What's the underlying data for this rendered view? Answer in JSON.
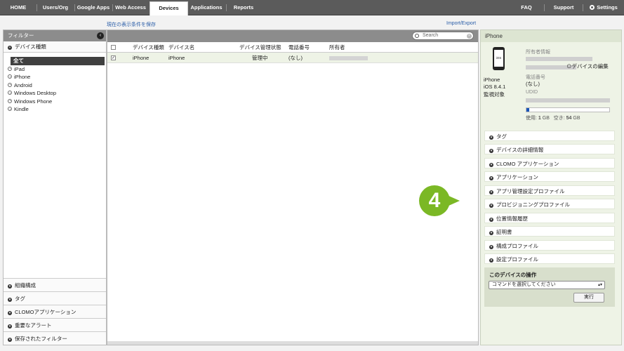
{
  "nav": {
    "home": "HOME",
    "users": "Users/Org",
    "google": "Google Apps",
    "web": "Web Access",
    "devices": "Devices",
    "applications": "Applications",
    "reports": "Reports",
    "faq": "FAQ",
    "support": "Support",
    "settings": "Settings"
  },
  "links": {
    "save_view": "現在の表示条件を保存",
    "import_export": "Import/Export"
  },
  "left": {
    "header": "フィルター",
    "section": "デバイス種類",
    "items": [
      "全て",
      "iPad",
      "iPhone",
      "Android",
      "Windows Desktop",
      "Windows Phone",
      "Kindle"
    ],
    "bottom": [
      "組織構成",
      "タグ",
      "CLOMOアプリケーション",
      "重要なアラート",
      "保存されたフィルター"
    ]
  },
  "search": {
    "placeholder": "Search"
  },
  "table": {
    "headers": [
      "デバイス種類",
      "デバイス名",
      "デバイス管理状態",
      "電話番号",
      "所有者"
    ],
    "rows": [
      {
        "type": "iPhone",
        "name": "iPhone",
        "status": "管理中",
        "phone": "(なし)",
        "checked": "✓"
      }
    ]
  },
  "right": {
    "header": "iPhone",
    "device_screen": "iOS",
    "device_model": "iPhone",
    "device_os": "iOS 8.4.1",
    "device_supervised": "監視対象",
    "owner_label": "所有者情報",
    "edit_link": "デバイスの編集",
    "phone_label": "電話番号",
    "phone_value": "(なし)",
    "udid_label": "UDID",
    "storage_used_label": "使用:",
    "storage_used_value": "1",
    "storage_free_label": "空き:",
    "storage_free_value": "54",
    "storage_unit": "GB",
    "storage_fraction": 0.018,
    "sections": [
      "タグ",
      "デバイスの詳細情報",
      "CLOMO アプリケーション",
      "アプリケーション",
      "アプリ管理設定プロファイル",
      "プロビジョニングプロファイル",
      "位置情報履歴",
      "証明書",
      "構成プロファイル",
      "設定プロファイル"
    ],
    "ops_title": "このデバイスの操作",
    "ops_select": "コマンドを選択してください",
    "ops_button": "実行"
  },
  "callout": "4",
  "colors": {
    "accent_green": "#7bb825",
    "nav_bg": "#5b5b5b",
    "storage_blue": "#1a56b8"
  }
}
